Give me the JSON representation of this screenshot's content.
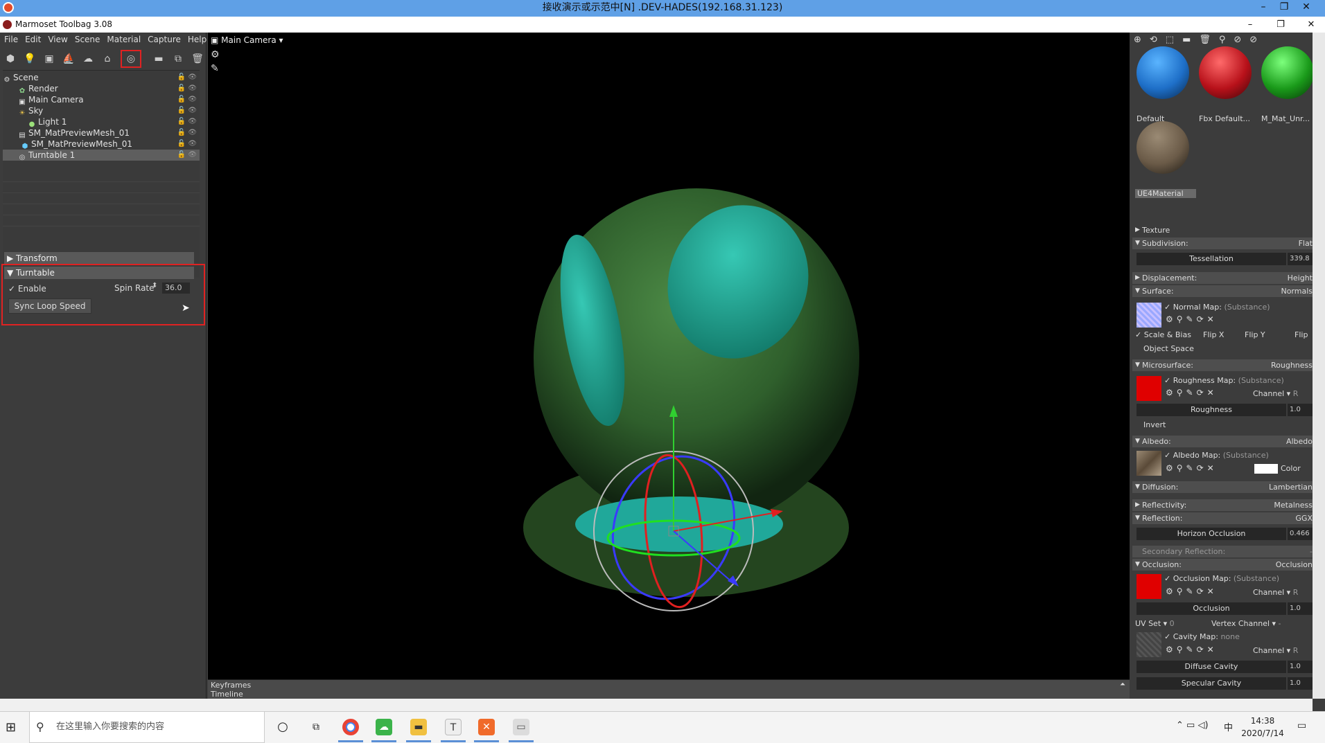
{
  "remote_title": "接收演示或示范中[N] .DEV-HADES(192.168.31.123)",
  "app_title": "Marmoset Toolbag 3.08",
  "menu": [
    "File",
    "Edit",
    "View",
    "Scene",
    "Material",
    "Capture",
    "Help"
  ],
  "scene_tree": [
    {
      "label": "Scene",
      "icon": "scene-icon"
    },
    {
      "label": "Render",
      "icon": "render-icon"
    },
    {
      "label": "Main Camera",
      "icon": "camera-icon"
    },
    {
      "label": "Sky",
      "icon": "sky-icon"
    },
    {
      "label": "Light 1",
      "icon": "light-icon"
    },
    {
      "label": "SM_MatPreviewMesh_01",
      "icon": "mesh-icon"
    },
    {
      "label": "SM_MatPreviewMesh_01",
      "icon": "mesh-icon"
    },
    {
      "label": "Turntable 1",
      "icon": "turntable-icon"
    }
  ],
  "props": {
    "transform_label": "Transform",
    "turntable_label": "Turntable",
    "enable_label": "Enable",
    "spin_rate_label": "Spin Rate",
    "spin_rate_value": "36.0",
    "sync_label": "Sync Loop Speed"
  },
  "viewport": {
    "camera_label": "Main Camera"
  },
  "timeline": {
    "keyframes": "Keyframes",
    "timeline": "Timeline"
  },
  "materials": [
    {
      "label": "Default",
      "color": "#1e6fc8"
    },
    {
      "label": "Fbx Default...",
      "color": "#b8111a"
    },
    {
      "label": "M_Mat_Unr...",
      "color": "#1a9a1a"
    },
    {
      "label": "UE4Material",
      "color": "#6b5b48"
    }
  ],
  "material_props": {
    "texture": "Texture",
    "subdivision": "Subdivision:",
    "subdivision_val": "Flat",
    "tessellation": "Tessellation",
    "tessellation_val": "339.8",
    "displacement": "Displacement:",
    "displacement_val": "Height",
    "surface": "Surface:",
    "surface_val": "Normals",
    "normal_map": "Normal Map:",
    "substance": "(Substance)",
    "scale_bias": "Scale & Bias",
    "flip_x": "Flip X",
    "flip_y": "Flip Y",
    "flip_z": "Flip",
    "object_space": "Object Space",
    "microsurface": "Microsurface:",
    "microsurface_val": "Roughness",
    "roughness_map": "Roughness Map:",
    "channel": "Channel",
    "channel_r": "R",
    "roughness": "Roughness",
    "roughness_val": "1.0",
    "invert": "Invert",
    "albedo": "Albedo:",
    "albedo_val": "Albedo",
    "albedo_map": "Albedo Map:",
    "color": "Color",
    "diffusion": "Diffusion:",
    "diffusion_val": "Lambertian",
    "reflectivity": "Reflectivity:",
    "reflectivity_val": "Metalness",
    "reflection": "Reflection:",
    "reflection_val": "GGX",
    "horizon_occlusion": "Horizon Occlusion",
    "horizon_val": "0.466",
    "secondary_reflection": "Secondary Reflection:",
    "secondary_val": "-",
    "occlusion": "Occlusion:",
    "occlusion_val": "Occlusion",
    "occlusion_map": "Occlusion Map:",
    "occlusion_label": "Occlusion",
    "occlusion_num": "1.0",
    "uv_set": "UV Set",
    "uv_val": "0",
    "vertex_channel": "Vertex Channel",
    "vertex_val": "-",
    "cavity_map": "Cavity Map:",
    "cavity_none": "none",
    "diffuse_cavity": "Diffuse Cavity",
    "diffuse_cavity_val": "1.0",
    "specular_cavity": "Specular Cavity",
    "specular_cavity_val": "1.0"
  },
  "taskbar": {
    "search_placeholder": "在这里输入你要搜索的内容",
    "time": "14:38",
    "date": "2020/7/14",
    "ime": "中"
  }
}
